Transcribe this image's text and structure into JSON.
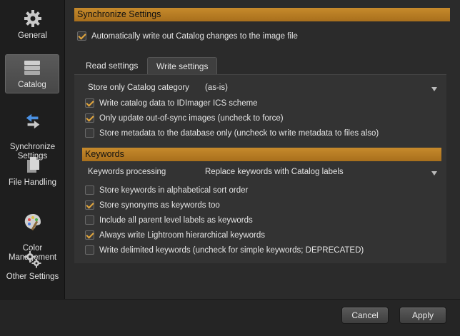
{
  "sidebar": {
    "items": [
      {
        "label": "General",
        "icon": "gear-icon"
      },
      {
        "label": "Catalog",
        "icon": "database-icon"
      },
      {
        "label": "Synchronize\nSettings",
        "icon": "sync-arrows-icon"
      },
      {
        "label": "File Handling",
        "icon": "files-icon"
      },
      {
        "label": "Color\nManagement",
        "icon": "palette-icon"
      },
      {
        "label": "Other Settings",
        "icon": "gears-icon"
      }
    ],
    "active": "Catalog"
  },
  "sync": {
    "header": "Synchronize Settings",
    "auto_write": {
      "label": "Automatically write out Catalog changes to the image file",
      "checked": true
    }
  },
  "tabs": [
    {
      "label": "Read settings",
      "active": false
    },
    {
      "label": "Write settings",
      "active": true
    }
  ],
  "write": {
    "store_only_label": "Store only Catalog category",
    "store_only_value": "(as-is)",
    "options": [
      {
        "label": "Write catalog data to IDImager ICS scheme",
        "checked": true
      },
      {
        "label": "Only update out-of-sync images (uncheck to force)",
        "checked": true
      },
      {
        "label": "Store metadata to the database only (uncheck to write metadata to files also)",
        "checked": false
      }
    ]
  },
  "keywords": {
    "header": "Keywords",
    "processing_label": "Keywords processing",
    "processing_value": "Replace keywords with Catalog labels",
    "options": [
      {
        "label": "Store keywords in alphabetical sort order",
        "checked": false
      },
      {
        "label": "Store synonyms as keywords too",
        "checked": true
      },
      {
        "label": "Include all parent level labels as keywords",
        "checked": false
      },
      {
        "label": "Always write Lightroom hierarchical keywords",
        "checked": true
      },
      {
        "label": "Write delimited keywords (uncheck for simple keywords; DEPRECATED)",
        "checked": false
      }
    ]
  },
  "footer": {
    "cancel_label": "Cancel",
    "apply_label": "Apply"
  },
  "colors": {
    "accent": "#c68a2c",
    "check": "#e3a63c",
    "background": "#2b2b2b",
    "sidebar": "#1e1e1e"
  }
}
